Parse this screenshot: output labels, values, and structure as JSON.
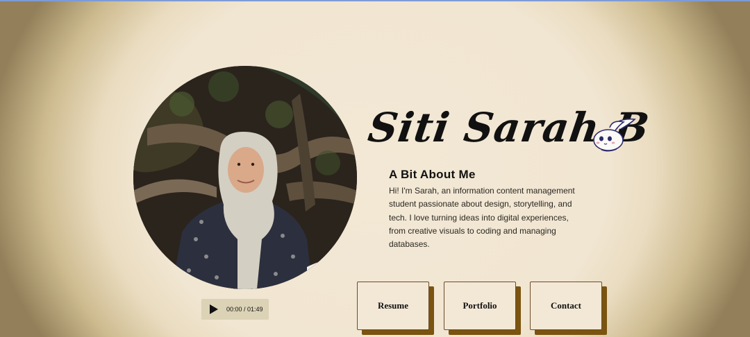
{
  "profile": {
    "name": "Siti Sarah B",
    "photo_icon": "portrait-photo",
    "mascot_icon": "bunny-icon"
  },
  "audio": {
    "time": "00:00 / 01:49",
    "play_icon": "play-icon"
  },
  "about": {
    "title": "A Bit About Me",
    "text": "Hi! I'm Sarah, an information content management student passionate about design, storytelling, and tech. I love turning ideas into digital experiences, from creative visuals to coding and managing databases."
  },
  "nav": {
    "resume": "Resume",
    "portfolio": "Portfolio",
    "contact": "Contact"
  },
  "colors": {
    "background": "#f3e8d5",
    "vignette": "#93805a",
    "button_shadow": "#7a5410",
    "text": "#111111"
  }
}
